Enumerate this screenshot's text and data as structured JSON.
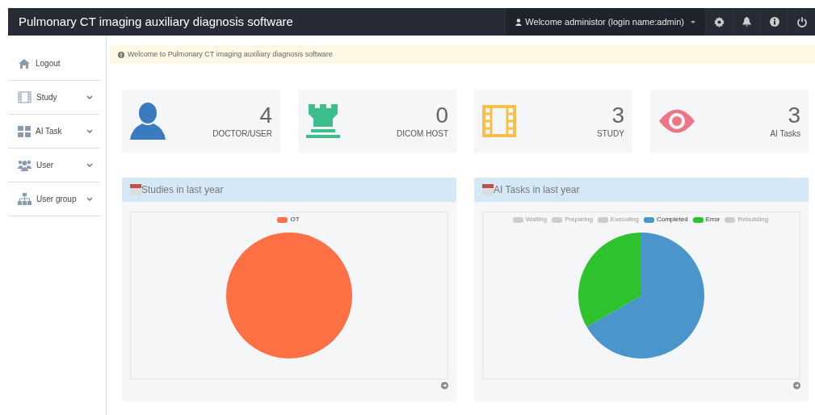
{
  "header": {
    "title": "Pulmonary CT imaging auxiliary diagnosis software",
    "user_menu": "Welcome administor (login name:admin)"
  },
  "sidebar": {
    "items": [
      {
        "kind": "home",
        "label": "Logout",
        "expandable": false
      },
      {
        "kind": "film",
        "label": "Study",
        "expandable": true
      },
      {
        "kind": "grid",
        "label": "AI Task",
        "expandable": true
      },
      {
        "kind": "users",
        "label": "User",
        "expandable": true
      },
      {
        "kind": "tree",
        "label": "User group",
        "expandable": true
      }
    ]
  },
  "alert": "Welcome to Pulmonary CT imaging auxiliary diagnosis software",
  "stats": [
    {
      "kind": "user",
      "value": "4",
      "label": "DOCTOR/USER",
      "color": "#3a7bc0"
    },
    {
      "kind": "rook",
      "value": "0",
      "label": "DICOM HOST",
      "color": "#3cbf8c"
    },
    {
      "kind": "film",
      "value": "3",
      "label": "STUDY",
      "color": "#f7c04a"
    },
    {
      "kind": "eye",
      "value": "3",
      "label": "AI Tasks",
      "color": "#ec7686"
    }
  ],
  "panels": [
    {
      "title": "Studies in last year",
      "chart_data": {
        "type": "pie",
        "categories": [
          "OT"
        ],
        "values": [
          100
        ],
        "colors": [
          "#ff7144"
        ],
        "legend": "top"
      }
    },
    {
      "title": "AI Tasks in last year",
      "chart_data": {
        "type": "pie",
        "categories": [
          "Waiting",
          "Preparing",
          "Executing",
          "Completed",
          "Error",
          "Rebuilding"
        ],
        "values": [
          null,
          null,
          null,
          66.7,
          33.3,
          null
        ],
        "colors": [
          "#cccccc",
          "#cccccc",
          "#cccccc",
          "#4a96cc",
          "#2ec22e",
          "#cccccc"
        ],
        "legend": "top"
      }
    }
  ]
}
